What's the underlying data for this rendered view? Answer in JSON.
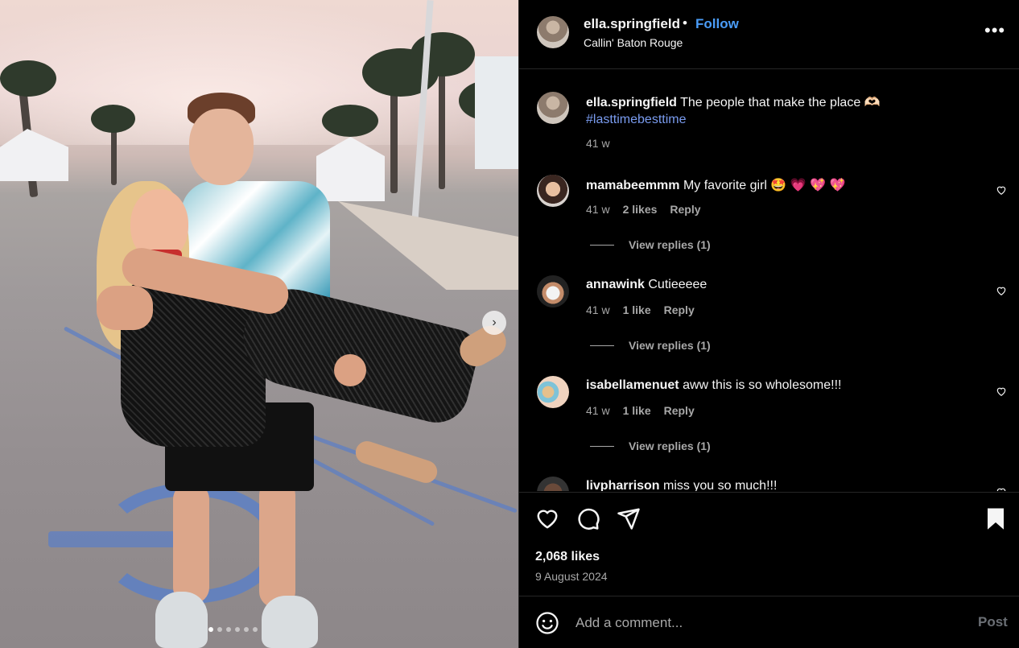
{
  "post": {
    "username": "ella.springfield",
    "separator": "•",
    "follow_label": "Follow",
    "location": "Callin' Baton Rouge",
    "more_label": "•••",
    "caption_text": "The people that make the place 🫶🏻",
    "hashtag": "#lasttimebesttime",
    "caption_age": "41 w",
    "carousel": {
      "next_label": "›",
      "slide_count": 6,
      "active_slide": 1
    }
  },
  "comments": [
    {
      "username": "mamabeemmm",
      "text": "My favorite girl 🤩 💗 💖 💖",
      "age": "41 w",
      "likes": "2 likes",
      "reply_label": "Reply",
      "view_replies": "View replies (1)"
    },
    {
      "username": "annawink",
      "text": "Cutieeeee",
      "age": "41 w",
      "likes": "1 like",
      "reply_label": "Reply",
      "view_replies": "View replies (1)"
    },
    {
      "username": "isabellamenuet",
      "text": "aww this is so wholesome!!!",
      "age": "41 w",
      "likes": "1 like",
      "reply_label": "Reply",
      "view_replies": "View replies (1)"
    },
    {
      "username": "livpharrison",
      "text": "miss you so much!!!"
    }
  ],
  "actions": {
    "likes": "2,068 likes",
    "date": "9 August 2024",
    "icons": [
      "heart-icon",
      "comment-icon",
      "share-icon",
      "bookmark-icon"
    ]
  },
  "add_comment": {
    "placeholder": "Add a comment...",
    "post_label": "Post"
  },
  "colors": {
    "follow": "#4a9cf7",
    "hashtag": "#7a9cf0",
    "muted": "#a8a8a8",
    "background": "#000000"
  }
}
